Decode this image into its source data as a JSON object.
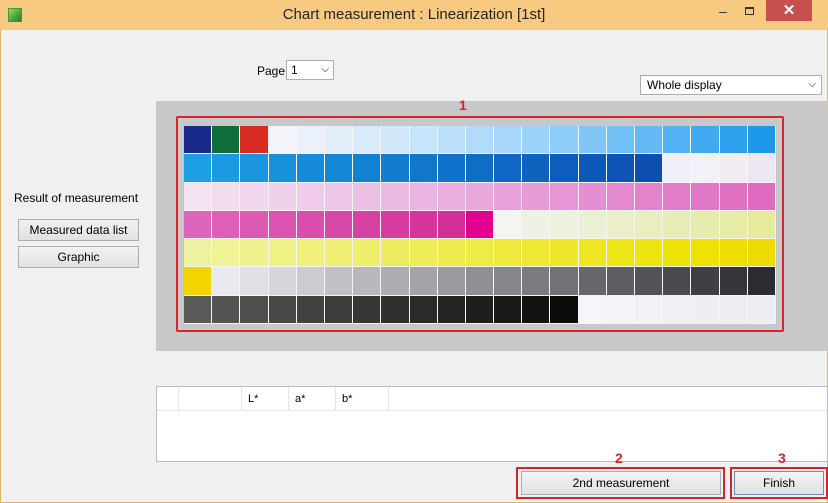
{
  "window": {
    "title": "Chart measurement : Linearization [1st]",
    "minimize_glyph": "–",
    "close_glyph": "✕"
  },
  "page": {
    "label": "Page",
    "value": "1"
  },
  "display": {
    "value": "Whole display"
  },
  "callouts": {
    "one": "1",
    "two": "2",
    "three": "3"
  },
  "sidebar": {
    "result_label": "Result of measurement",
    "measured_data_list": "Measured data list",
    "graphic": "Graphic"
  },
  "table": {
    "columns": [
      "",
      "",
      "L*",
      "a*",
      "b*"
    ]
  },
  "buttons": {
    "second_measurement": "2nd measurement",
    "finish": "Finish"
  },
  "chart": {
    "rows": [
      [
        "#1a2a8a",
        "#0f6e3a",
        "#d92b22",
        "#f3f5fb",
        "#eaf1fb",
        "#e2eefa",
        "#d9ebfa",
        "#d0e8fa",
        "#c6e4fa",
        "#bce0f9",
        "#b1dbf9",
        "#a6d7f9",
        "#9ad2f8",
        "#8ecdf8",
        "#80c7f7",
        "#72c1f6",
        "#63baf5",
        "#52b2f3",
        "#40a9f1",
        "#2ea0ee",
        "#1d97ea"
      ],
      [
        "#1f9fe3",
        "#1c9ae1",
        "#1a95de",
        "#1890dc",
        "#168bd9",
        "#1486d6",
        "#1381d3",
        "#127cd0",
        "#1177cd",
        "#1072ca",
        "#0f6dc6",
        "#0e68c3",
        "#0e63bf",
        "#0d5ebc",
        "#0d59b8",
        "#0d54b5",
        "#0d4fb1",
        "#f0eef6",
        "#f4f0f7",
        "#f2ecf5",
        "#efe6f3"
      ],
      [
        "#f3e3f1",
        "#f2ddef",
        "#f1d7ed",
        "#f0d1eb",
        "#efcbe9",
        "#eec5e7",
        "#edbfe5",
        "#ecb9e3",
        "#ebb3e1",
        "#eaadde",
        "#e9a7dc",
        "#e8a1da",
        "#e79bd7",
        "#e695d5",
        "#e58fd2",
        "#e489cf",
        "#e383cc",
        "#e27dc9",
        "#e177c6",
        "#e071c3",
        "#df6bc0"
      ],
      [
        "#de65bc",
        "#dd5fb8",
        "#dc59b4",
        "#db53b0",
        "#da4dac",
        "#d947a8",
        "#d841a4",
        "#d63ba0",
        "#d5359c",
        "#d42f98",
        "#e2008e",
        "#f4f4f0",
        "#f0f1e6",
        "#eef1dd",
        "#ecf0d3",
        "#eaefc9",
        "#e9eec0",
        "#e8edb7",
        "#e7ecae",
        "#e6eba5",
        "#e5ea9c"
      ],
      [
        "#eff2a0",
        "#eff297",
        "#eff18e",
        "#eff085",
        "#eff07c",
        "#eeef73",
        "#eeee6a",
        "#eeed61",
        "#eeec58",
        "#eeeb4f",
        "#eeea46",
        "#eee93d",
        "#eee834",
        "#eee72b",
        "#eee622",
        "#eee519",
        "#eee410",
        "#eee307",
        "#eee200",
        "#eede00",
        "#eed900"
      ],
      [
        "#f2d500",
        "#eaeaee",
        "#e0e0e4",
        "#d6d6da",
        "#ccccd0",
        "#c2c2c6",
        "#b8b8bc",
        "#aeaeb2",
        "#a4a4a8",
        "#9a9a9e",
        "#909094",
        "#86868a",
        "#7c7c80",
        "#727276",
        "#68686c",
        "#5e5e62",
        "#545458",
        "#4a4a4e",
        "#404044",
        "#36363a",
        "#2c2c30"
      ],
      [
        "#5a5a58",
        "#545452",
        "#4e4e4c",
        "#484846",
        "#424240",
        "#3c3c3a",
        "#363634",
        "#30302e",
        "#2a2a28",
        "#242422",
        "#1e1e1c",
        "#181816",
        "#121210",
        "#0c0c0a",
        "#f6f6fa",
        "#f3f3f8",
        "#f1f1f7",
        "#efeff5",
        "#eeeef4",
        "#ededf3",
        "#ececf2"
      ]
    ]
  }
}
